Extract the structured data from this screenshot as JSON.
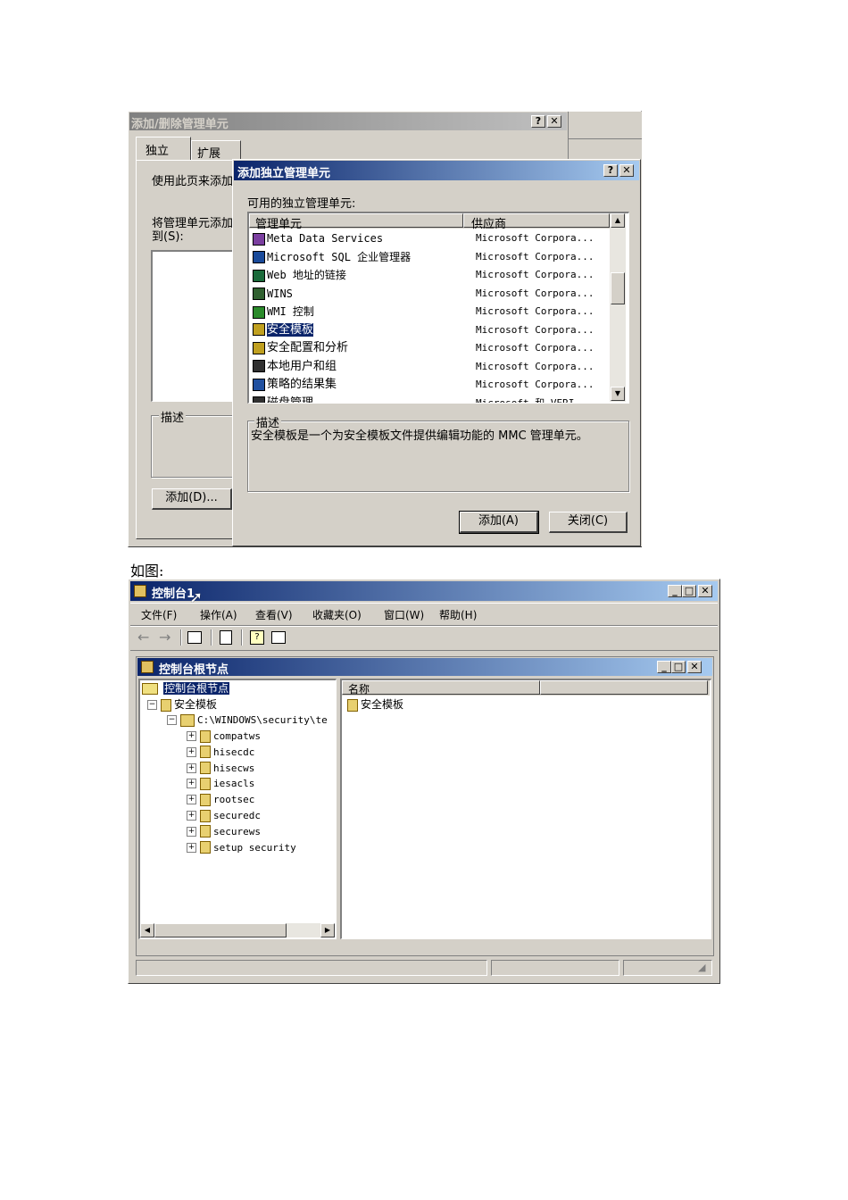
{
  "back_dialog": {
    "title": "添加/删除管理单元",
    "tabs": [
      "独立",
      "扩展"
    ],
    "intro_text": "使用此页来添加",
    "add_to_label": "将管理单元添加",
    "add_to_label2": "到(S):",
    "description_group": "描述",
    "add_button": "添加(D)..."
  },
  "add_dialog": {
    "title": "添加独立管理单元",
    "available_label": "可用的独立管理单元:",
    "columns": [
      "管理单元",
      "供应商"
    ],
    "items": [
      {
        "name": "Meta Data Services",
        "vendor": "Microsoft Corpora...",
        "icon": "tools-icon"
      },
      {
        "name": "Microsoft SQL 企业管理器",
        "vendor": "Microsoft Corpora...",
        "icon": "sql-server-icon"
      },
      {
        "name": "Web 地址的链接",
        "vendor": "Microsoft Corpora...",
        "icon": "web-link-icon"
      },
      {
        "name": "WINS",
        "vendor": "Microsoft Corpora...",
        "icon": "wins-icon"
      },
      {
        "name": "WMI 控制",
        "vendor": "Microsoft Corpora...",
        "icon": "wmi-icon"
      },
      {
        "name": "安全模板",
        "vendor": "Microsoft Corpora...",
        "icon": "security-template-icon",
        "selected": true
      },
      {
        "name": "安全配置和分析",
        "vendor": "Microsoft Corpora...",
        "icon": "security-config-icon"
      },
      {
        "name": "本地用户和组",
        "vendor": "Microsoft Corpora...",
        "icon": "users-icon"
      },
      {
        "name": "策略的结果集",
        "vendor": "Microsoft Corpora...",
        "icon": "policy-icon"
      },
      {
        "name": "磁盘管理",
        "vendor": "Microsoft 和 VERI...",
        "icon": "disk-icon"
      }
    ],
    "description_group": "描述",
    "description_text": "安全模板是一个为安全模板文件提供编辑功能的 MMC 管理单元。",
    "add_button": "添加(A)",
    "close_button": "关闭(C)"
  },
  "caption": "如图:",
  "console": {
    "title": "控制台1",
    "menu": [
      "文件(F)",
      "操作(A)",
      "查看(V)",
      "收藏夹(O)",
      "窗口(W)",
      "帮助(H)"
    ],
    "child_title": "控制台根节点",
    "tree": {
      "root": "控制台根节点",
      "security_templates": "安全模板",
      "path": "C:\\WINDOWS\\security\\te",
      "templates": [
        "compatws",
        "hisecdc",
        "hisecws",
        "iesacls",
        "rootsec",
        "securedc",
        "securews",
        "setup security"
      ]
    },
    "list_columns": [
      "名称"
    ],
    "list_items": [
      "安全模板"
    ]
  },
  "colors": {
    "title_active": "#0a246a",
    "title_gradient_end": "#a6caf0",
    "face": "#d4d0c8",
    "selection": "#0a246a"
  }
}
